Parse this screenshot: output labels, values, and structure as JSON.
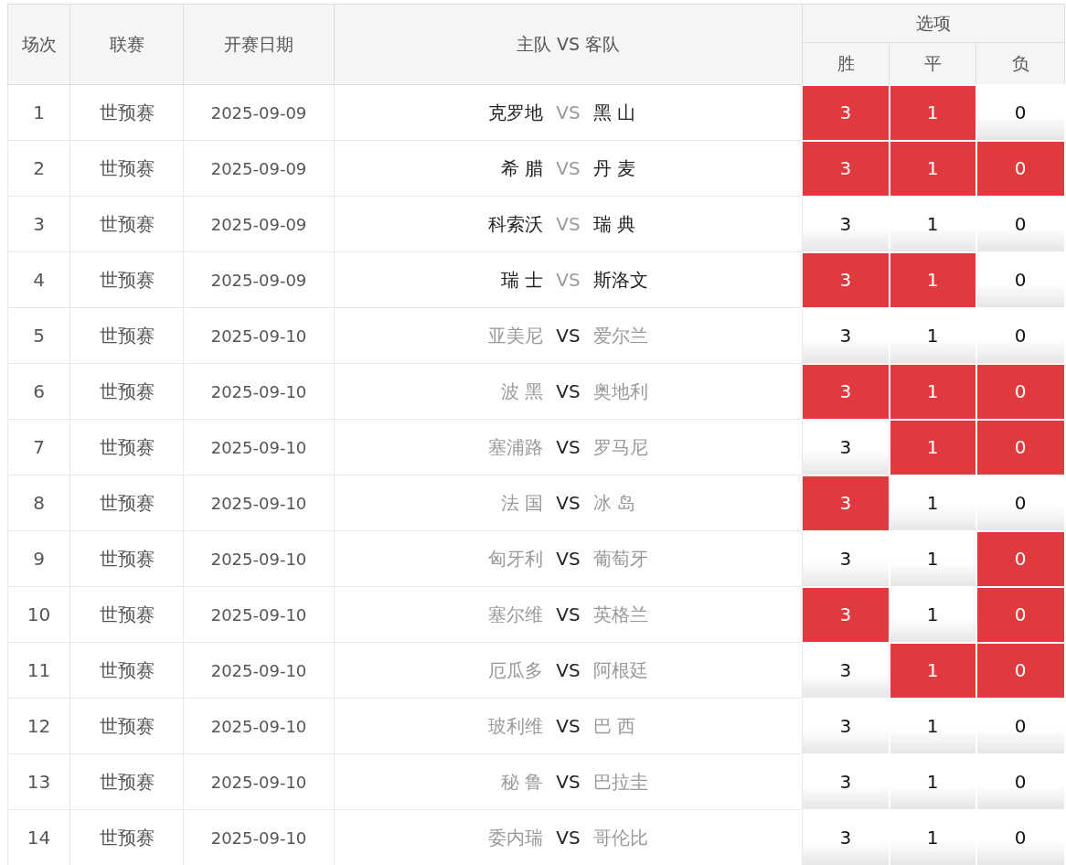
{
  "table": {
    "columns": [
      "场次",
      "联赛",
      "开赛日期",
      "主队 VS 客队"
    ],
    "options_header": "选项",
    "option_columns": [
      "胜",
      "平",
      "负"
    ],
    "rows": [
      {
        "no": "1",
        "league": "世预赛",
        "date": "2025-09-09",
        "home": "克罗地",
        "vs": "VS",
        "away": "黑 山",
        "greyed": false,
        "options": [
          {
            "label": "3",
            "selected": true
          },
          {
            "label": "1",
            "selected": true
          },
          {
            "label": "0",
            "selected": false
          }
        ]
      },
      {
        "no": "2",
        "league": "世预赛",
        "date": "2025-09-09",
        "home": "希 腊",
        "vs": "VS",
        "away": "丹 麦",
        "greyed": false,
        "options": [
          {
            "label": "3",
            "selected": true
          },
          {
            "label": "1",
            "selected": true
          },
          {
            "label": "0",
            "selected": true
          }
        ]
      },
      {
        "no": "3",
        "league": "世预赛",
        "date": "2025-09-09",
        "home": "科索沃",
        "vs": "VS",
        "away": "瑞 典",
        "greyed": false,
        "options": [
          {
            "label": "3",
            "selected": false
          },
          {
            "label": "1",
            "selected": false
          },
          {
            "label": "0",
            "selected": false
          }
        ]
      },
      {
        "no": "4",
        "league": "世预赛",
        "date": "2025-09-09",
        "home": "瑞 士",
        "vs": "VS",
        "away": "斯洛文",
        "greyed": false,
        "options": [
          {
            "label": "3",
            "selected": true
          },
          {
            "label": "1",
            "selected": true
          },
          {
            "label": "0",
            "selected": false
          }
        ]
      },
      {
        "no": "5",
        "league": "世预赛",
        "date": "2025-09-10",
        "home": "亚美尼",
        "vs": "VS",
        "away": "爱尔兰",
        "greyed": true,
        "options": [
          {
            "label": "3",
            "selected": false
          },
          {
            "label": "1",
            "selected": false
          },
          {
            "label": "0",
            "selected": false
          }
        ]
      },
      {
        "no": "6",
        "league": "世预赛",
        "date": "2025-09-10",
        "home": "波 黑",
        "vs": "VS",
        "away": "奥地利",
        "greyed": true,
        "options": [
          {
            "label": "3",
            "selected": true
          },
          {
            "label": "1",
            "selected": true
          },
          {
            "label": "0",
            "selected": true
          }
        ]
      },
      {
        "no": "7",
        "league": "世预赛",
        "date": "2025-09-10",
        "home": "塞浦路",
        "vs": "VS",
        "away": "罗马尼",
        "greyed": true,
        "options": [
          {
            "label": "3",
            "selected": false
          },
          {
            "label": "1",
            "selected": true
          },
          {
            "label": "0",
            "selected": true
          }
        ]
      },
      {
        "no": "8",
        "league": "世预赛",
        "date": "2025-09-10",
        "home": "法 国",
        "vs": "VS",
        "away": "冰 岛",
        "greyed": true,
        "options": [
          {
            "label": "3",
            "selected": true
          },
          {
            "label": "1",
            "selected": false
          },
          {
            "label": "0",
            "selected": false
          }
        ]
      },
      {
        "no": "9",
        "league": "世预赛",
        "date": "2025-09-10",
        "home": "匈牙利",
        "vs": "VS",
        "away": "葡萄牙",
        "greyed": true,
        "options": [
          {
            "label": "3",
            "selected": false
          },
          {
            "label": "1",
            "selected": false
          },
          {
            "label": "0",
            "selected": true
          }
        ]
      },
      {
        "no": "10",
        "league": "世预赛",
        "date": "2025-09-10",
        "home": "塞尔维",
        "vs": "VS",
        "away": "英格兰",
        "greyed": true,
        "options": [
          {
            "label": "3",
            "selected": true
          },
          {
            "label": "1",
            "selected": false
          },
          {
            "label": "0",
            "selected": true
          }
        ]
      },
      {
        "no": "11",
        "league": "世预赛",
        "date": "2025-09-10",
        "home": "厄瓜多",
        "vs": "VS",
        "away": "阿根廷",
        "greyed": true,
        "options": [
          {
            "label": "3",
            "selected": false
          },
          {
            "label": "1",
            "selected": true
          },
          {
            "label": "0",
            "selected": true
          }
        ]
      },
      {
        "no": "12",
        "league": "世预赛",
        "date": "2025-09-10",
        "home": "玻利维",
        "vs": "VS",
        "away": "巴 西",
        "greyed": true,
        "options": [
          {
            "label": "3",
            "selected": false
          },
          {
            "label": "1",
            "selected": false
          },
          {
            "label": "0",
            "selected": false
          }
        ]
      },
      {
        "no": "13",
        "league": "世预赛",
        "date": "2025-09-10",
        "home": "秘 鲁",
        "vs": "VS",
        "away": "巴拉圭",
        "greyed": true,
        "options": [
          {
            "label": "3",
            "selected": false
          },
          {
            "label": "1",
            "selected": false
          },
          {
            "label": "0",
            "selected": false
          }
        ]
      },
      {
        "no": "14",
        "league": "世预赛",
        "date": "2025-09-10",
        "home": "委内瑞",
        "vs": "VS",
        "away": "哥伦比",
        "greyed": true,
        "options": [
          {
            "label": "3",
            "selected": false
          },
          {
            "label": "1",
            "selected": false
          },
          {
            "label": "0",
            "selected": false
          }
        ]
      }
    ]
  }
}
